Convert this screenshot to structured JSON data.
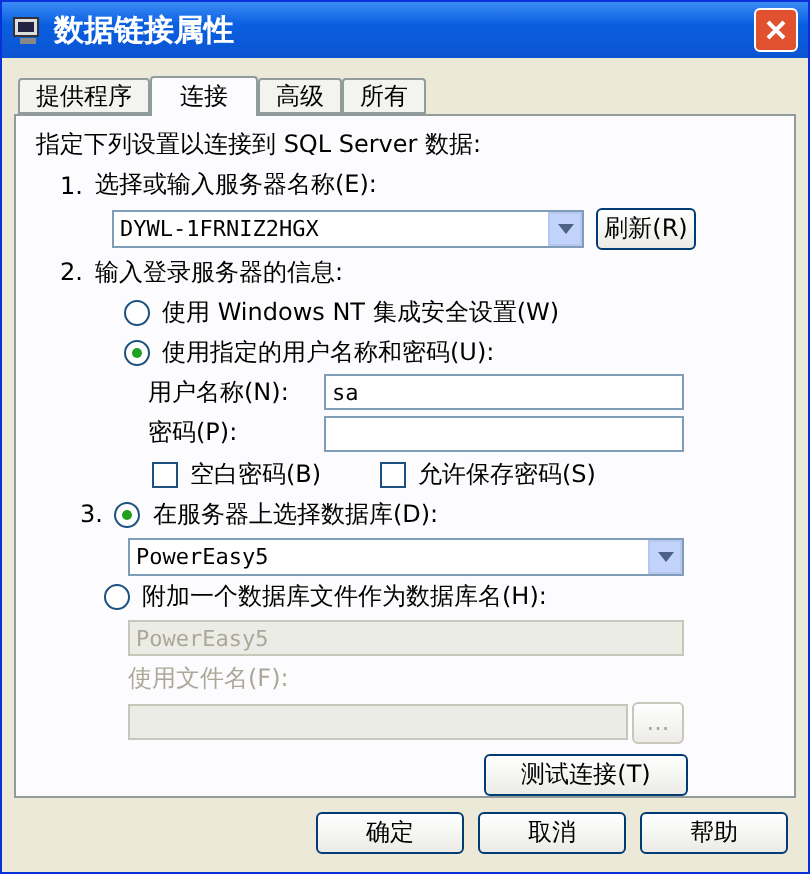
{
  "window": {
    "title": "数据链接属性"
  },
  "tabs": [
    {
      "label": "提供程序",
      "selected": false
    },
    {
      "label": "连接",
      "selected": true
    },
    {
      "label": "高级",
      "selected": false
    },
    {
      "label": "所有",
      "selected": false
    }
  ],
  "intro": "指定下列设置以连接到 SQL Server 数据:",
  "step1": {
    "number": "1.",
    "label": "选择或输入服务器名称(E):",
    "server": "DYWL-1FRNIZ2HGX",
    "refresh_button": "刷新(R)"
  },
  "step2": {
    "number": "2.",
    "label": "输入登录服务器的信息:",
    "auth_options": [
      {
        "label": "使用 Windows NT 集成安全设置(W)",
        "selected": false
      },
      {
        "label": "使用指定的用户名称和密码(U):",
        "selected": true
      }
    ],
    "username_label": "用户名称(N):",
    "username": "sa",
    "password_label": "密码(P):",
    "checkboxes": [
      {
        "label": "空白密码(B)",
        "checked": false
      },
      {
        "label": "允许保存密码(S)",
        "checked": false
      }
    ]
  },
  "step3": {
    "number": "3.",
    "db_options": [
      {
        "label": "在服务器上选择数据库(D):",
        "selected": true
      },
      {
        "label": "附加一个数据库文件作为数据库名(H):",
        "selected": false
      }
    ],
    "database": "PowerEasy5",
    "attach_name": "PowerEasy5",
    "file_label": "使用文件名(F):",
    "browse_button": "...",
    "test_button": "测试连接(T)"
  },
  "buttons": [
    "确定",
    "取消",
    "帮助"
  ]
}
